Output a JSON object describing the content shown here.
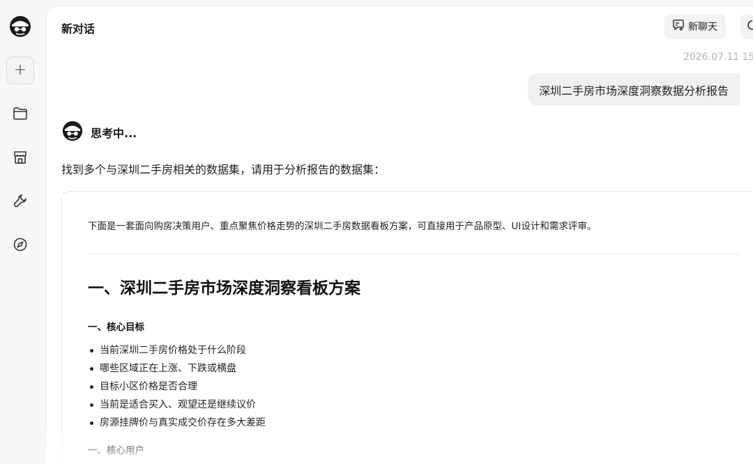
{
  "sidebar": {
    "items": [
      {
        "icon": "spy-avatar-icon"
      },
      {
        "icon": "plus-icon",
        "label": "+"
      },
      {
        "icon": "folder-icon"
      },
      {
        "icon": "store-icon"
      },
      {
        "icon": "wrench-icon"
      },
      {
        "icon": "compass-icon"
      }
    ]
  },
  "header": {
    "title": "新对话",
    "new_chat_label": "新聊天",
    "new_chat_icon": "chat-plus-icon",
    "history_icon": "history-icon"
  },
  "conversation": {
    "timestamp": "2026.07.11 15",
    "user_message": "深圳二手房市场深度洞察数据分析报告",
    "thinking_label": "思考中...",
    "reply_intro": "找到多个与深圳二手房相关的数据集，请用于分析报告的数据集："
  },
  "card": {
    "intro": "下面是一套面向购房决策用户、重点聚焦价格走势的深圳二手房数据看板方案，可直接用于产品原型、UI设计和需求评审。",
    "heading": "一、深圳二手房市场深度洞察看板方案",
    "section1_title": "一、核心目标",
    "bullets": [
      "当前深圳二手房价格处于什么阶段",
      "哪些区域正在上涨、下跌或横盘",
      "目标小区价格是否合理",
      "当前是适合买入、观望还是继续议价",
      "房源挂牌价与真实成交价存在多大差距"
    ],
    "section2_title": "一、核心用户"
  },
  "colors": {
    "background": "#f7f7f8",
    "panel": "#ffffff",
    "bubble": "#f1f1f2",
    "muted_text": "#b4b4b4"
  }
}
